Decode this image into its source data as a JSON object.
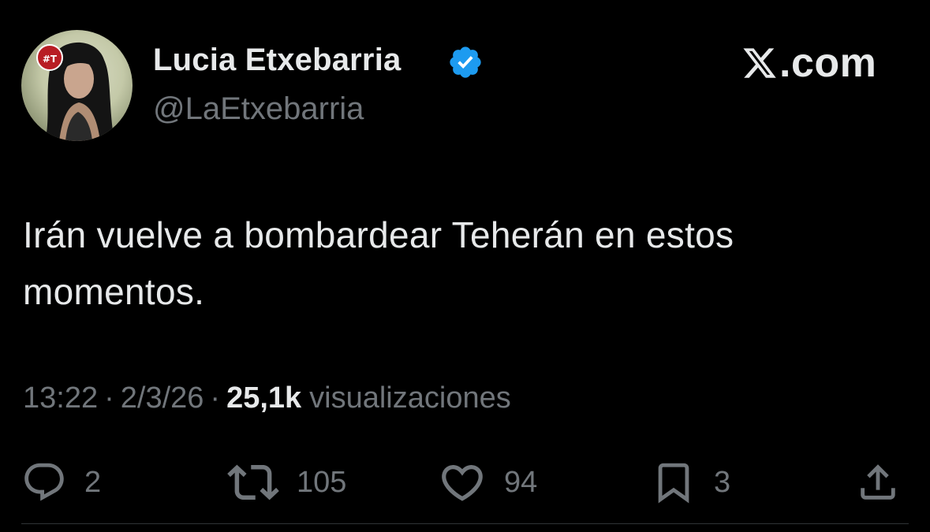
{
  "author": {
    "display_name": "Lucia Etxebarria",
    "handle": "@LaEtxebarria",
    "avatar_badge": "#T",
    "verified": true,
    "verified_color": "#1d9bf0"
  },
  "brand": {
    "label": ".com",
    "icon": "x-logo-icon"
  },
  "tweet": {
    "text": "Irán vuelve a bombardear Teherán en estos momentos."
  },
  "meta": {
    "time": "13:22",
    "separator": "·",
    "date": "2/3/26",
    "views_count": "25,1k",
    "views_label": "visualizaciones"
  },
  "actions": {
    "reply": {
      "icon": "reply-icon",
      "count": "2"
    },
    "retweet": {
      "icon": "retweet-icon",
      "count": "105"
    },
    "like": {
      "icon": "heart-icon",
      "count": "94"
    },
    "bookmark": {
      "icon": "bookmark-icon",
      "count": "3"
    },
    "share": {
      "icon": "share-icon"
    }
  },
  "colors": {
    "background": "#000000",
    "primary_text": "#e7e9ea",
    "secondary_text": "#71767b",
    "divider": "#2f3336"
  }
}
